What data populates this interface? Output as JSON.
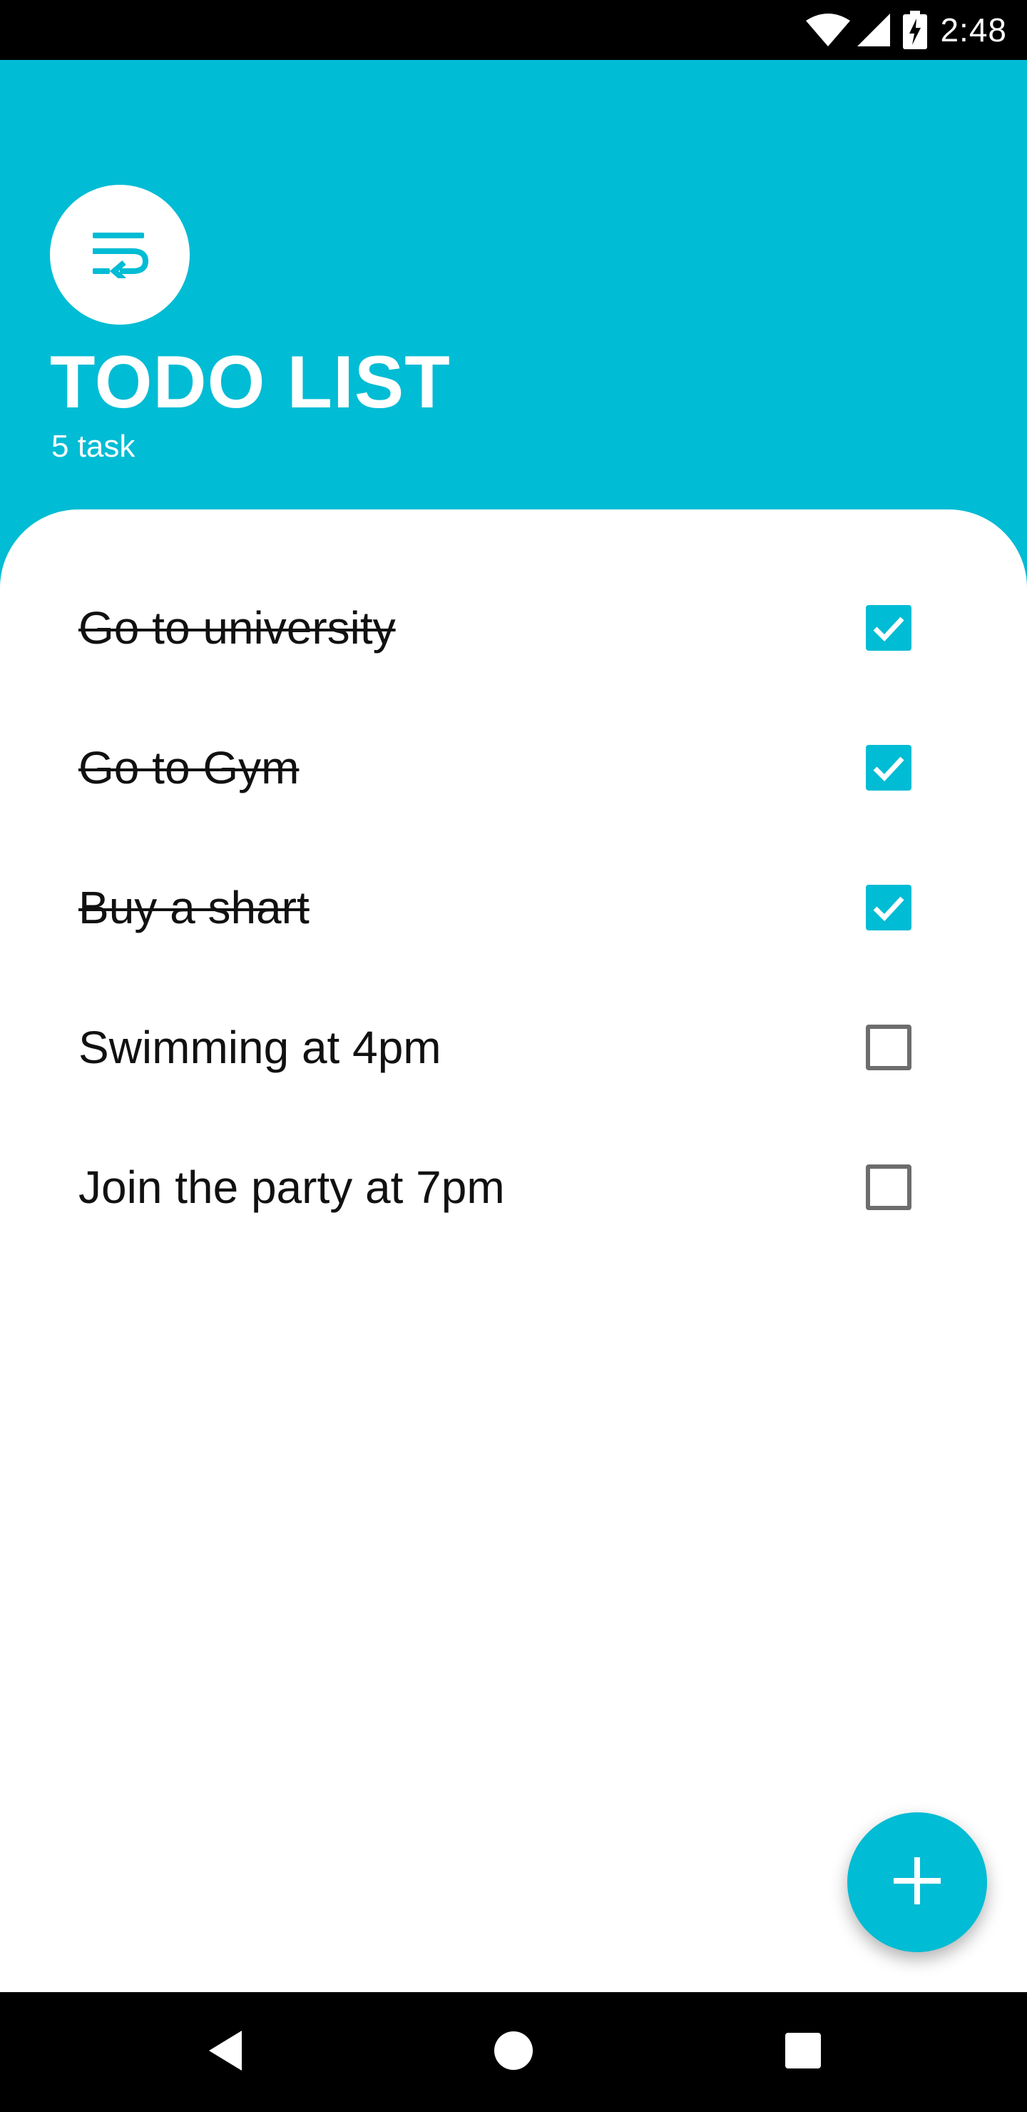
{
  "status_bar": {
    "time": "2:48",
    "icons": [
      "wifi-icon",
      "cell-signal-icon",
      "battery-charging-icon"
    ]
  },
  "header": {
    "icon": "wrap-text-icon",
    "title": "TODO LIST",
    "subtitle": "5 task"
  },
  "tasks": [
    {
      "label": "Go to university",
      "done": true
    },
    {
      "label": "Go to Gym",
      "done": true
    },
    {
      "label": "Buy a shart",
      "done": true
    },
    {
      "label": "Swimming at 4pm",
      "done": false
    },
    {
      "label": "Join the party at 7pm",
      "done": false
    }
  ],
  "fab": {
    "icon": "plus-icon"
  },
  "nav_bar": {
    "icons": [
      "back-icon",
      "home-icon",
      "recents-icon"
    ]
  },
  "colors": {
    "accent": "#00bcd4",
    "status_bar": "#000000",
    "background": "#ffffff",
    "text": "#111111",
    "unchecked_border": "#6d6d6d"
  }
}
